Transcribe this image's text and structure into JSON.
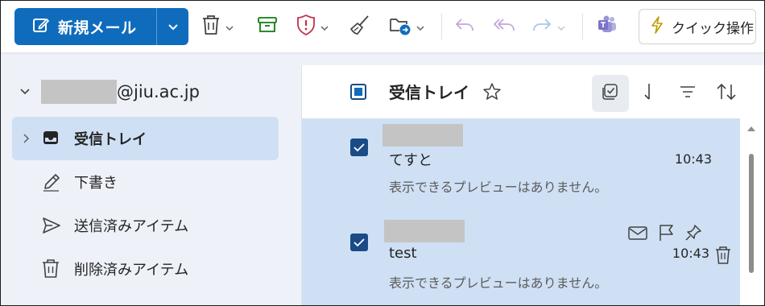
{
  "toolbar": {
    "new_mail_label": "新規メール",
    "quick_action_label": "クイック操作",
    "icons": [
      "compose-icon",
      "chevron-down-icon",
      "trash-icon",
      "archive-icon",
      "report-shield-icon",
      "sweep-icon",
      "move-folder-icon",
      "reply-icon",
      "reply-all-icon",
      "forward-icon",
      "teams-icon",
      "lightning-icon"
    ],
    "colors": {
      "primary": "#0f6cbd",
      "archive": "#107c10",
      "report": "#c4314b",
      "move": "#0f6cbd"
    }
  },
  "account": {
    "email_suffix": "@jiu.ac.jp"
  },
  "folders": [
    {
      "label": "受信トレイ",
      "selected": true,
      "icon": "inbox-icon"
    },
    {
      "label": "下書き",
      "selected": false,
      "icon": "pencil-icon"
    },
    {
      "label": "送信済みアイテム",
      "selected": false,
      "icon": "send-icon"
    },
    {
      "label": "削除済みアイテム",
      "selected": false,
      "icon": "trash-icon"
    }
  ],
  "list": {
    "title": "受信トレイ",
    "messages": [
      {
        "subject": "てすと",
        "time": "10:43",
        "preview": "表示できるプレビューはありません。",
        "checked": true
      },
      {
        "subject": "test",
        "time": "10:43",
        "preview": "表示できるプレビューはありません。",
        "checked": true
      }
    ]
  }
}
